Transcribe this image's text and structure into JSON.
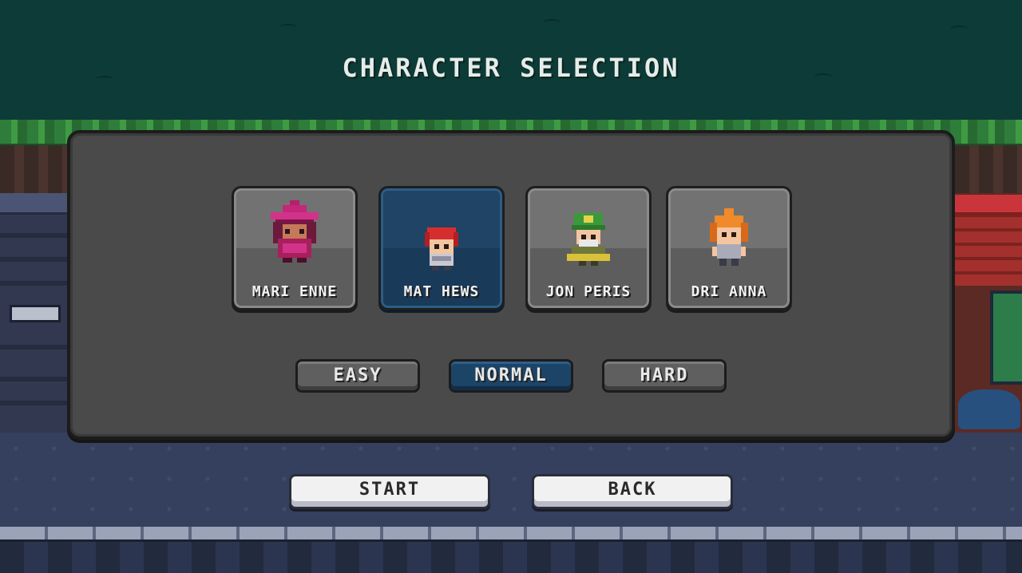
{
  "screen": {
    "title": "CHARACTER SELECTION"
  },
  "characters": [
    {
      "name": "MARI ENNE",
      "icon": "witch-character-icon",
      "selected": false
    },
    {
      "name": "MAT HEWS",
      "icon": "red-hair-character-icon",
      "selected": true
    },
    {
      "name": "JON PERIS",
      "icon": "green-hat-character-icon",
      "selected": false
    },
    {
      "name": "DRI ANNA",
      "icon": "orange-hair-character-icon",
      "selected": false
    }
  ],
  "difficulty": {
    "options": [
      "EASY",
      "NORMAL",
      "HARD"
    ],
    "selected": "NORMAL"
  },
  "actions": {
    "start_label": "START",
    "back_label": "BACK"
  },
  "colors": {
    "selected": "#1c4466",
    "panel": "#4a4a4a",
    "sky": "#0d3b37"
  }
}
